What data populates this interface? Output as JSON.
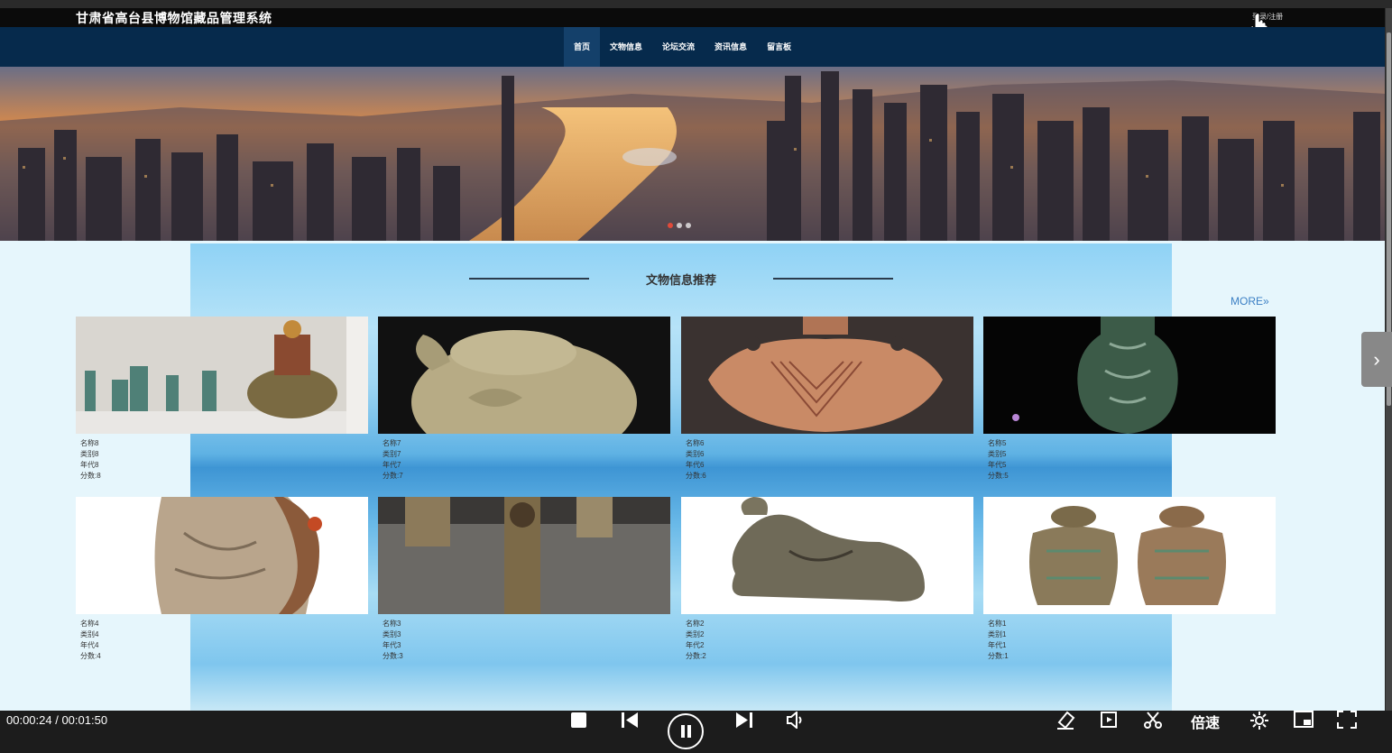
{
  "site": {
    "title": "甘肃省高台县博物馆藏品管理系统",
    "login_label": "登录/注册"
  },
  "nav": {
    "items": [
      "首页",
      "文物信息",
      "论坛交流",
      "资讯信息",
      "留言板"
    ],
    "active_index": 0
  },
  "banner": {
    "slide_count": 3,
    "active_slide": 0
  },
  "section": {
    "title": "文物信息推荐",
    "more_label": "MORE»"
  },
  "cards": [
    {
      "name": "名称8",
      "category": "类别8",
      "era": "年代8",
      "score": "分数:8"
    },
    {
      "name": "名称7",
      "category": "类别7",
      "era": "年代7",
      "score": "分数:7"
    },
    {
      "name": "名称6",
      "category": "类别6",
      "era": "年代6",
      "score": "分数:6"
    },
    {
      "name": "名称5",
      "category": "类别5",
      "era": "年代5",
      "score": "分数:5"
    },
    {
      "name": "名称4",
      "category": "类别4",
      "era": "年代4",
      "score": "分数:4"
    },
    {
      "name": "名称3",
      "category": "类别3",
      "era": "年代3",
      "score": "分数:3"
    },
    {
      "name": "名称2",
      "category": "类别2",
      "era": "年代2",
      "score": "分数:2"
    },
    {
      "name": "名称1",
      "category": "类别1",
      "era": "年代1",
      "score": "分数:1"
    }
  ],
  "player": {
    "time": "00:00:24 / 00:01:50",
    "speed_label": "倍速"
  }
}
